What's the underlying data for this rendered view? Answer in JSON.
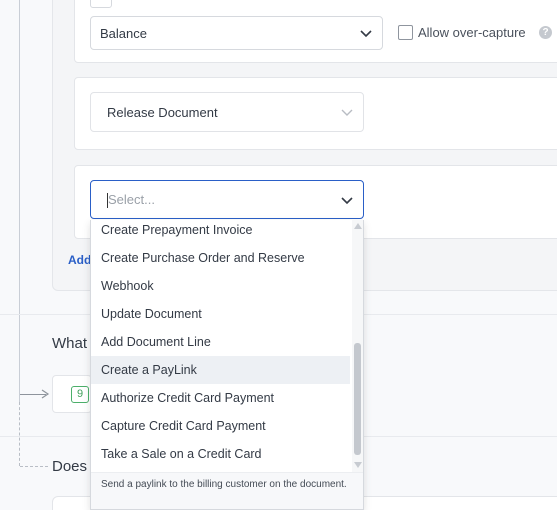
{
  "form": {
    "balance_select": {
      "value": "Balance"
    },
    "allow_overcapture": {
      "label": "Allow over-capture",
      "checked": false
    },
    "help_icon_glyph": "?",
    "release_select": {
      "value": "Release Document"
    },
    "action_select": {
      "placeholder": "Select...",
      "options": [
        {
          "label": "Create Prepayment Invoice"
        },
        {
          "label": "Create Purchase Order and Reserve"
        },
        {
          "label": "Webhook"
        },
        {
          "label": "Update Document"
        },
        {
          "label": "Add Document Line"
        },
        {
          "label": "Create a PayLink",
          "highlighted": true
        },
        {
          "label": "Authorize Credit Card Payment"
        },
        {
          "label": "Capture Credit Card Payment"
        },
        {
          "label": "Take a Sale on a Credit Card"
        }
      ],
      "highlighted_description": "Send a paylink to the billing customer on the document."
    },
    "add_link": "Add"
  },
  "steps": {
    "what_question": "What",
    "badge_count": "9",
    "does_question": "Does"
  },
  "colors": {
    "accent": "#2a5fc7",
    "badge_green": "#3f9e5a",
    "highlight_row": "#edf0f4"
  },
  "icons": [
    "chevron-down-icon",
    "help-icon",
    "arrow-right-icon",
    "scroll-up-icon",
    "scroll-down-icon"
  ]
}
